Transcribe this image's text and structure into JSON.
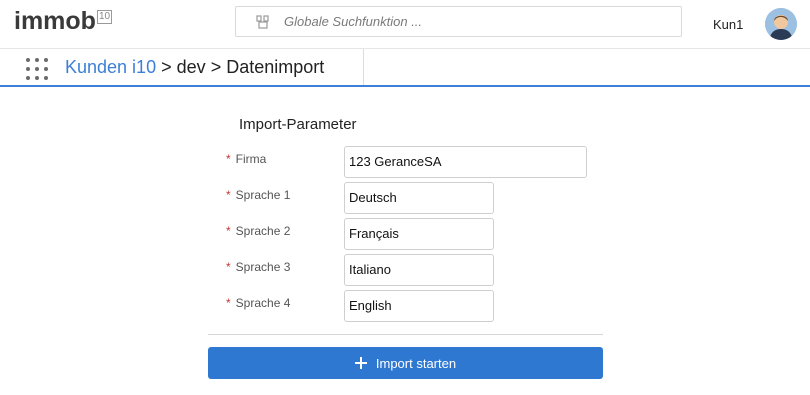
{
  "header": {
    "logo_text": "immob",
    "logo_sup": "10",
    "search_placeholder": "Globale Suchfunktion ...",
    "user_name": "Kun1"
  },
  "breadcrumb": {
    "root": "Kunden i10",
    "sep1": ">",
    "level2": "dev",
    "sep2": ">",
    "current": "Datenimport"
  },
  "form": {
    "title": "Import-Parameter",
    "required_marker": "*",
    "fields": [
      {
        "label": "Firma",
        "value": "123 GeranceSA"
      },
      {
        "label": "Sprache 1",
        "value": "Deutsch"
      },
      {
        "label": "Sprache 2",
        "value": "Français"
      },
      {
        "label": "Sprache 3",
        "value": "Italiano"
      },
      {
        "label": "Sprache 4",
        "value": "English"
      }
    ],
    "submit_label": "Import starten"
  },
  "colors": {
    "accent": "#2e78d2",
    "required": "#c23934",
    "link": "#3d7fd6"
  }
}
